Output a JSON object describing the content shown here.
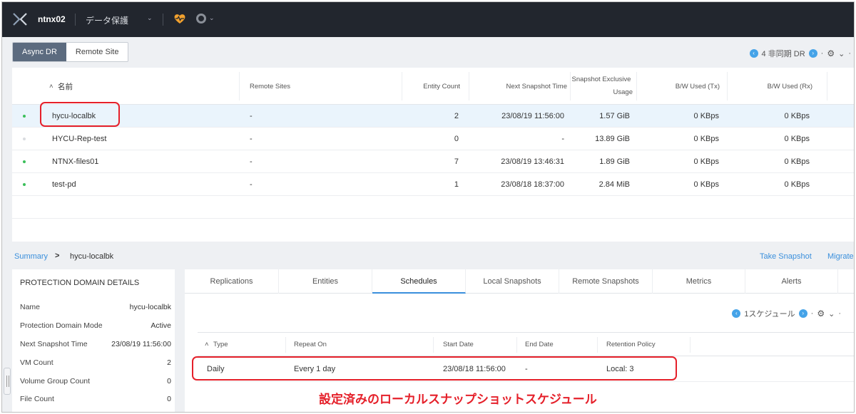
{
  "topbar": {
    "cluster_name": "ntnx02",
    "view_name": "データ保護",
    "view_chevron": "⌄",
    "alert_chevron": "⌄",
    "colors": {
      "bar": "#22262e",
      "health": "#f2a12e"
    }
  },
  "subbar": {
    "tabs": [
      {
        "label": "Async DR",
        "active": true
      },
      {
        "label": "Remote Site",
        "active": false
      }
    ],
    "count_label": "4 非同期 DR",
    "sep": "·"
  },
  "main_table": {
    "headers": {
      "sort": "˄",
      "name": "名前",
      "remote_sites": "Remote Sites",
      "entity_count": "Entity Count",
      "next_snapshot": "Next Snapshot Time",
      "snapshot_exclusive_1": "Snapshot Exclusive",
      "snapshot_exclusive_2": "Usage",
      "bw_tx": "B/W Used (Tx)",
      "bw_rx": "B/W Used (Rx)"
    },
    "rows": [
      {
        "name": "hycu-localbk",
        "remote": "-",
        "count": "2",
        "next": "23/08/19 11:56:00",
        "usage": "1.57 GiB",
        "tx": "0 KBps",
        "rx": "0 KBps",
        "status": "green"
      },
      {
        "name": "HYCU-Rep-test",
        "remote": "-",
        "count": "0",
        "next": "-",
        "usage": "13.89 GiB",
        "tx": "0 KBps",
        "rx": "0 KBps",
        "status": "grey"
      },
      {
        "name": "NTNX-files01",
        "remote": "-",
        "count": "7",
        "next": "23/08/19 13:46:31",
        "usage": "1.89 GiB",
        "tx": "0 KBps",
        "rx": "0 KBps",
        "status": "green"
      },
      {
        "name": "test-pd",
        "remote": "-",
        "count": "1",
        "next": "23/08/18 18:37:00",
        "usage": "2.84 MiB",
        "tx": "0 KBps",
        "rx": "0 KBps",
        "status": "green"
      }
    ]
  },
  "breadcrumb": {
    "summary": "Summary",
    "arrow": ">",
    "current": "hycu-localbk",
    "take_snapshot": "Take Snapshot",
    "migrate": "Migrate"
  },
  "details": {
    "title": "PROTECTION DOMAIN DETAILS",
    "rows": [
      {
        "key": "Name",
        "value": "hycu-localbk"
      },
      {
        "key": "Protection Domain Mode",
        "value": "Active"
      },
      {
        "key": "Next Snapshot Time",
        "value": "23/08/19 11:56:00"
      },
      {
        "key": "VM Count",
        "value": "2"
      },
      {
        "key": "Volume Group Count",
        "value": "0"
      },
      {
        "key": "File Count",
        "value": "0"
      }
    ]
  },
  "tabs": [
    {
      "label": "Replications",
      "active": false
    },
    {
      "label": "Entities",
      "active": false
    },
    {
      "label": "Schedules",
      "active": true
    },
    {
      "label": "Local Snapshots",
      "active": false
    },
    {
      "label": "Remote Snapshots",
      "active": false
    },
    {
      "label": "Metrics",
      "active": false
    },
    {
      "label": "Alerts",
      "active": false
    }
  ],
  "schedules": {
    "count_label": "1スケジュール",
    "sep": "·",
    "headers": {
      "sort": "˄",
      "type": "Type",
      "repeat_on": "Repeat On",
      "start_date": "Start Date",
      "end_date": "End Date",
      "retention": "Retention Policy"
    },
    "rows": [
      {
        "type": "Daily",
        "repeat": "Every 1 day",
        "start": "23/08/18 11:56:00",
        "end": "-",
        "retention": "Local: 3"
      }
    ]
  },
  "annotation": {
    "text": "設定済みのローカルスナップショットスケジュール",
    "color": "#e5202a"
  },
  "icons": {
    "left": "‹",
    "right": "›",
    "gear": "⚙",
    "chevron": "⌄"
  }
}
